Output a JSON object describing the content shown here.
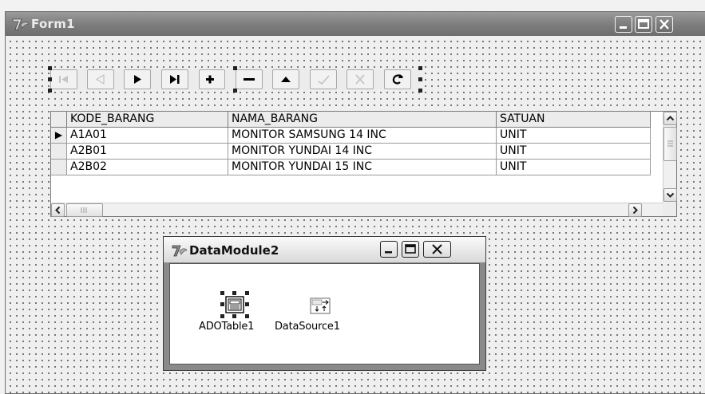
{
  "form": {
    "title": "Form1",
    "icon": "delphi-icon",
    "caption_buttons": [
      "minimize",
      "maximize",
      "close"
    ]
  },
  "navigator": {
    "buttons": [
      {
        "name": "first",
        "icon": "first-record-icon",
        "enabled": false
      },
      {
        "name": "prior",
        "icon": "prior-record-icon",
        "enabled": false
      },
      {
        "name": "next",
        "icon": "next-record-icon",
        "enabled": true
      },
      {
        "name": "last",
        "icon": "last-record-icon",
        "enabled": true
      },
      {
        "name": "insert",
        "icon": "plus-icon",
        "enabled": true
      },
      {
        "name": "delete",
        "icon": "minus-icon",
        "enabled": true
      },
      {
        "name": "edit",
        "icon": "edit-triangle-icon",
        "enabled": true
      },
      {
        "name": "post",
        "icon": "check-icon",
        "enabled": false
      },
      {
        "name": "cancel",
        "icon": "cancel-x-icon",
        "enabled": false
      },
      {
        "name": "refresh",
        "icon": "refresh-icon",
        "enabled": true
      }
    ]
  },
  "grid": {
    "columns": [
      "KODE_BARANG",
      "NAMA_BARANG",
      "SATUAN"
    ],
    "rows": [
      {
        "kode": "A1A01",
        "nama": "MONITOR SAMSUNG 14 INC",
        "satuan": "UNIT",
        "current": true
      },
      {
        "kode": "A2B01",
        "nama": "MONITOR YUNDAI 14 INC",
        "satuan": "UNIT",
        "current": false
      },
      {
        "kode": "A2B02",
        "nama": "MONITOR YUNDAI 15 INC",
        "satuan": "UNIT",
        "current": false
      }
    ],
    "current_row_indicator": "▶"
  },
  "datamodule": {
    "title": "DataModule2",
    "components": [
      {
        "label": "ADOTable1",
        "icon": "ado-table-icon",
        "selected": true
      },
      {
        "label": "DataSource1",
        "icon": "datasource-icon",
        "selected": false
      }
    ]
  },
  "colors": {
    "form_titlebar": "#7c7c7c",
    "datamodule_titlebar": "#eeeeee",
    "surface": "#efefef",
    "grid_bg": "#ffffff"
  }
}
